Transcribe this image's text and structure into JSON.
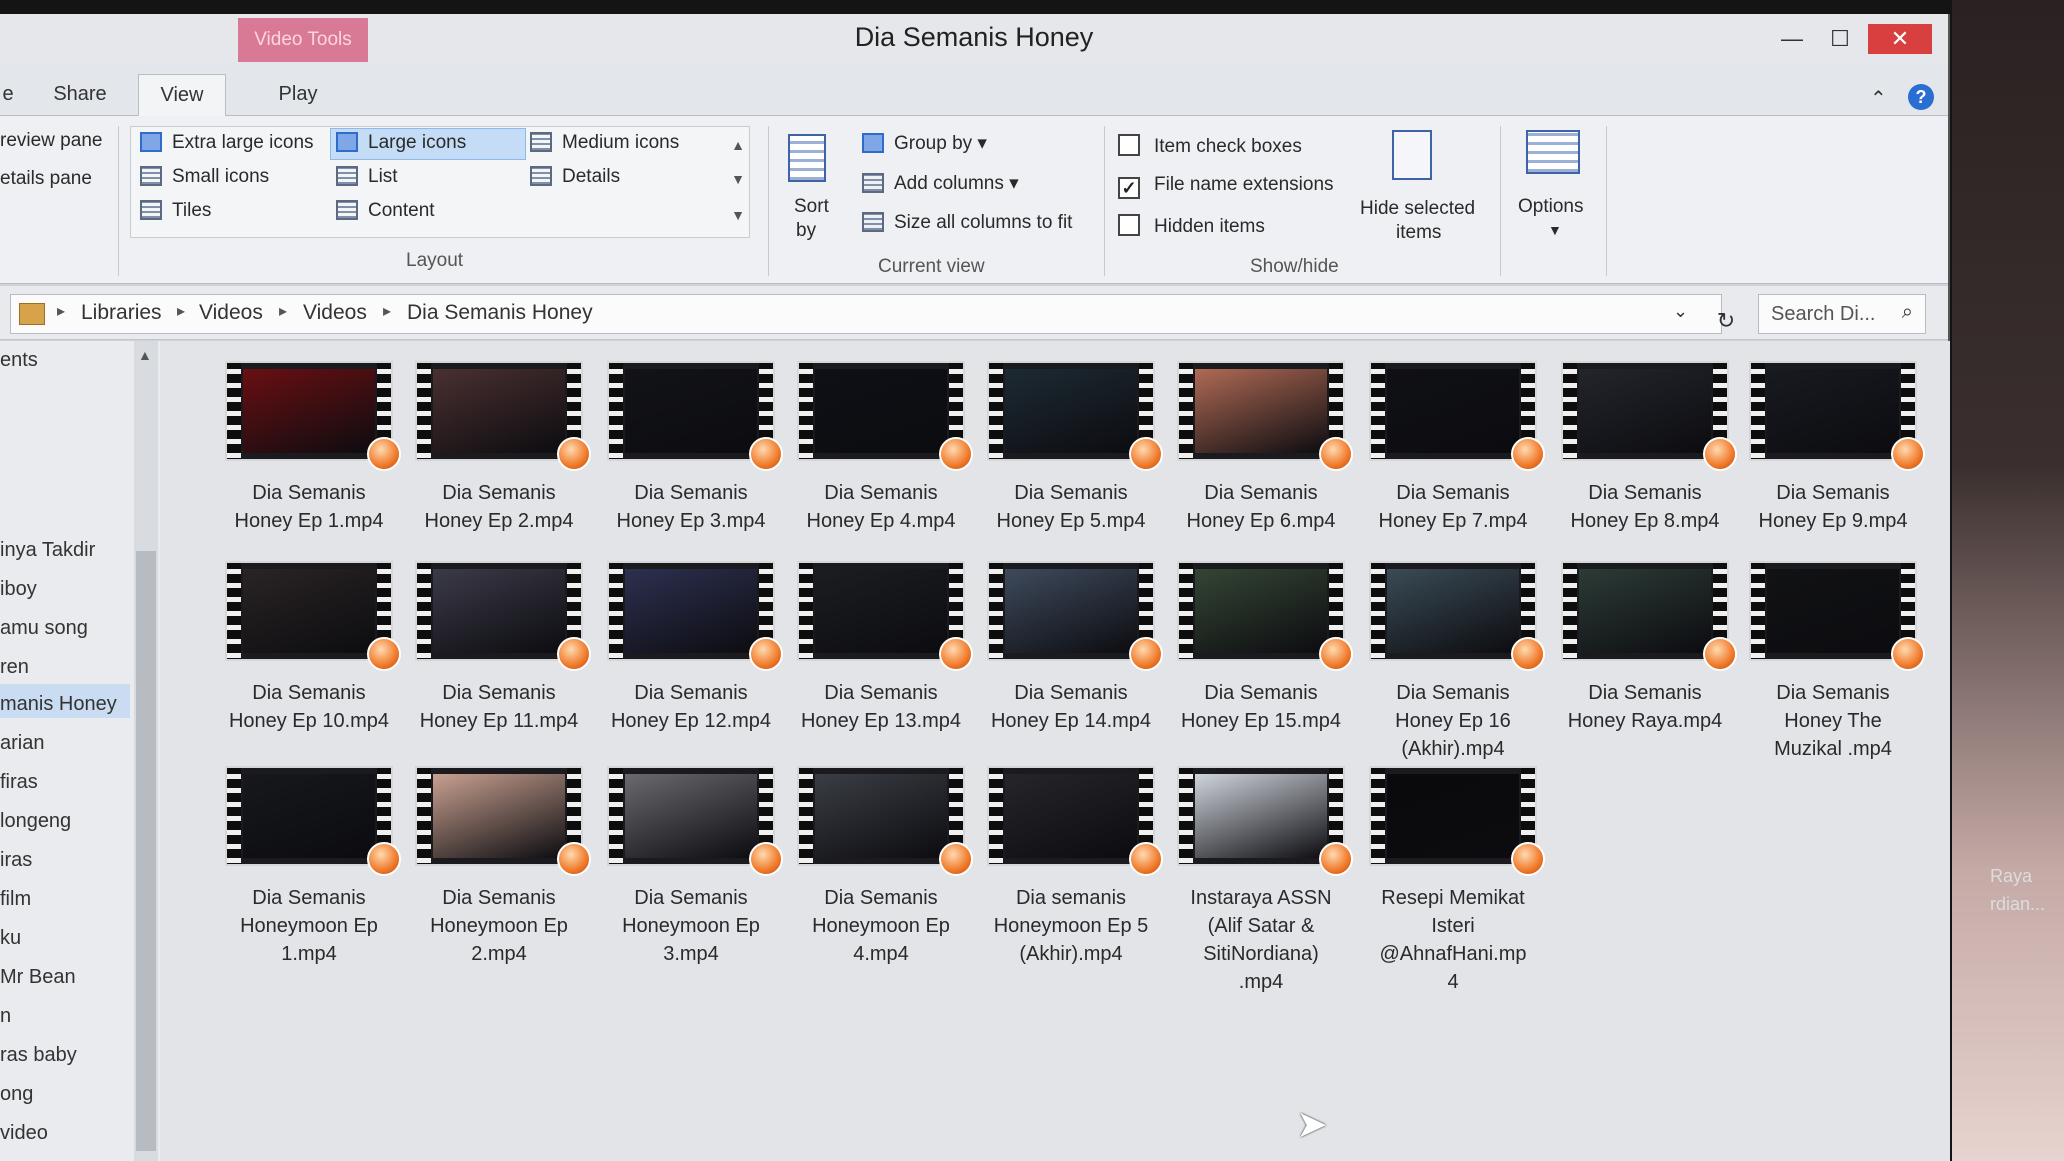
{
  "window": {
    "title": "Dia Semanis Honey",
    "context_tab": "Video Tools"
  },
  "tabs": [
    {
      "label": "e"
    },
    {
      "label": "Share"
    },
    {
      "label": "View"
    },
    {
      "label": "Play"
    }
  ],
  "ribbon": {
    "panes": {
      "preview": "review pane",
      "details": "etails pane"
    },
    "layout": {
      "extra_large": "Extra large icons",
      "large": "Large icons",
      "medium": "Medium icons",
      "small": "Small icons",
      "list": "List",
      "details": "Details",
      "tiles": "Tiles",
      "content": "Content",
      "group_label": "Layout"
    },
    "current_view": {
      "sort": "Sort",
      "sort_by": "by",
      "group_by": "Group by",
      "add_columns": "Add columns",
      "size_columns": "Size all columns to fit",
      "group_label": "Current view"
    },
    "show_hide": {
      "item_check_boxes": "Item check boxes",
      "file_name_extensions": "File name extensions",
      "hidden_items": "Hidden items",
      "hide_selected_line1": "Hide selected",
      "hide_selected_line2": "items",
      "group_label": "Show/hide"
    },
    "options": "Options"
  },
  "address": {
    "crumbs": [
      "Libraries",
      "Videos",
      "Videos",
      "Dia Semanis Honey"
    ],
    "search_placeholder": "Search Di..."
  },
  "nav": {
    "items": [
      "ents",
      "inya Takdir",
      "iboy",
      "amu song",
      "ren",
      "manis Honey",
      "arian",
      "firas",
      "longeng",
      "iras",
      "film",
      "ku",
      "Mr Bean",
      "n",
      "ras baby",
      "ong",
      "video"
    ]
  },
  "files": [
    {
      "l1": "Dia Semanis",
      "l2": "Honey Ep 1.mp4",
      "l3": "",
      "l4": "",
      "color": "#6a0f12"
    },
    {
      "l1": "Dia Semanis",
      "l2": "Honey Ep 2.mp4",
      "l3": "",
      "l4": "",
      "color": "#4a3030"
    },
    {
      "l1": "Dia Semanis",
      "l2": "Honey Ep 3.mp4",
      "l3": "",
      "l4": "",
      "color": "#121318"
    },
    {
      "l1": "Dia Semanis",
      "l2": "Honey Ep 4.mp4",
      "l3": "",
      "l4": "",
      "color": "#0e1016"
    },
    {
      "l1": "Dia Semanis",
      "l2": "Honey Ep 5.mp4",
      "l3": "",
      "l4": "",
      "color": "#1d2a33"
    },
    {
      "l1": "Dia Semanis",
      "l2": "Honey Ep 6.mp4",
      "l3": "",
      "l4": "",
      "color": "#b06a55"
    },
    {
      "l1": "Dia Semanis",
      "l2": "Honey Ep 7.mp4",
      "l3": "",
      "l4": "",
      "color": "#101114"
    },
    {
      "l1": "Dia Semanis",
      "l2": "Honey Ep 8.mp4",
      "l3": "",
      "l4": "",
      "color": "#23252c"
    },
    {
      "l1": "Dia Semanis",
      "l2": "Honey Ep 9.mp4",
      "l3": "",
      "l4": "",
      "color": "#171a20"
    },
    {
      "l1": "Dia Semanis",
      "l2": "Honey Ep 10.mp4",
      "l3": "",
      "l4": "",
      "color": "#2a2424"
    },
    {
      "l1": "Dia Semanis",
      "l2": "Honey Ep 11.mp4",
      "l3": "",
      "l4": "",
      "color": "#3b3a48"
    },
    {
      "l1": "Dia Semanis",
      "l2": "Honey Ep 12.mp4",
      "l3": "",
      "l4": "",
      "color": "#2d3050"
    },
    {
      "l1": "Dia Semanis",
      "l2": "Honey Ep 13.mp4",
      "l3": "",
      "l4": "",
      "color": "#1b1d22"
    },
    {
      "l1": "Dia Semanis",
      "l2": "Honey Ep 14.mp4",
      "l3": "",
      "l4": "",
      "color": "#3e4a5c"
    },
    {
      "l1": "Dia Semanis",
      "l2": "Honey Ep 15.mp4",
      "l3": "",
      "l4": "",
      "color": "#344534"
    },
    {
      "l1": "Dia Semanis",
      "l2": "Honey Ep 16",
      "l3": "(Akhir).mp4",
      "l4": "",
      "color": "#3a4b55"
    },
    {
      "l1": "Dia Semanis",
      "l2": "Honey Raya.mp4",
      "l3": "",
      "l4": "",
      "color": "#2c3b36"
    },
    {
      "l1": "Dia Semanis",
      "l2": "Honey The",
      "l3": "Muzikal .mp4",
      "l4": "",
      "color": "#111214"
    },
    {
      "l1": "Dia Semanis",
      "l2": "Honeymoon Ep",
      "l3": "1.mp4",
      "l4": "",
      "color": "#16181c"
    },
    {
      "l1": "Dia Semanis",
      "l2": "Honeymoon Ep",
      "l3": "2.mp4",
      "l4": "",
      "color": "#c8a090"
    },
    {
      "l1": "Dia Semanis",
      "l2": "Honeymoon Ep",
      "l3": "3.mp4",
      "l4": "",
      "color": "#6a6a6e"
    },
    {
      "l1": "Dia Semanis",
      "l2": "Honeymoon Ep",
      "l3": "4.mp4",
      "l4": "",
      "color": "#3a3d44"
    },
    {
      "l1": "Dia semanis",
      "l2": "Honeymoon Ep 5",
      "l3": "(Akhir).mp4",
      "l4": "",
      "color": "#26262a"
    },
    {
      "l1": "Instaraya ASSN",
      "l2": "(Alif Satar &",
      "l3": "SitiNordiana)",
      "l4": ".mp4",
      "color": "#d0d4dc"
    },
    {
      "l1": "Resepi Memikat",
      "l2": "Isteri",
      "l3": "@AhnafHani.mp",
      "l4": "4",
      "color": "#0a0a0c"
    }
  ],
  "desktop": {
    "texts": [
      "Raya",
      "rdian..."
    ]
  }
}
